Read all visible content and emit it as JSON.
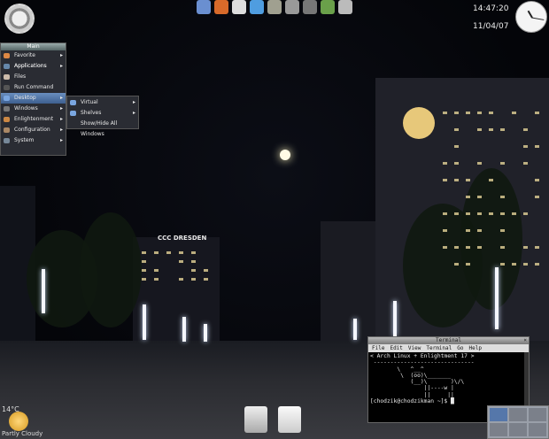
{
  "clock": {
    "time": "14:47:20",
    "date": "11/04/07"
  },
  "tray_icons": [
    "finder-icon",
    "firefox-icon",
    "file-icon",
    "trident-icon",
    "notepad-icon",
    "folder-icon",
    "ship-icon",
    "palm-icon",
    "camera-icon"
  ],
  "main_menu": {
    "title": "Main",
    "items": [
      {
        "label": "Favorite Applications",
        "icon": "star-icon",
        "submenu": true
      },
      {
        "label": "Applications",
        "icon": "apps-icon",
        "submenu": true
      },
      {
        "label": "Files",
        "icon": "files-icon",
        "submenu": false
      },
      {
        "label": "Run Command",
        "icon": "run-icon",
        "submenu": false
      },
      {
        "label": "Desktop",
        "icon": "desktop-icon",
        "submenu": true,
        "selected": true
      },
      {
        "label": "Windows",
        "icon": "windows-icon",
        "submenu": true
      },
      {
        "label": "Enlightenment",
        "icon": "e-icon",
        "submenu": true
      },
      {
        "label": "Configuration",
        "icon": "config-icon",
        "submenu": true
      },
      {
        "label": "System",
        "icon": "system-icon",
        "submenu": true
      }
    ]
  },
  "desktop_submenu": {
    "items": [
      {
        "label": "Virtual",
        "submenu": true
      },
      {
        "label": "Shelves",
        "submenu": true
      },
      {
        "label": "Show/Hide All Windows",
        "submenu": false
      }
    ]
  },
  "terminal": {
    "title": "Terminal",
    "menubar": [
      "File",
      "Edit",
      "View",
      "Terminal",
      "Go",
      "Help"
    ],
    "lines": [
      "< Arch Linux + Enlightment 17 >",
      " ------------------------------",
      "        \\   ^__^",
      "         \\  (oo)\\_______",
      "            (__)\\       )\\/\\",
      "                ||----w |",
      "                ||     ||",
      "[chodzik@chodzikman ~]$ "
    ]
  },
  "weather": {
    "temp": "14°C",
    "condition": "Partly Cloudy"
  },
  "signs": {
    "ccc": "CCC DRESDEN"
  }
}
